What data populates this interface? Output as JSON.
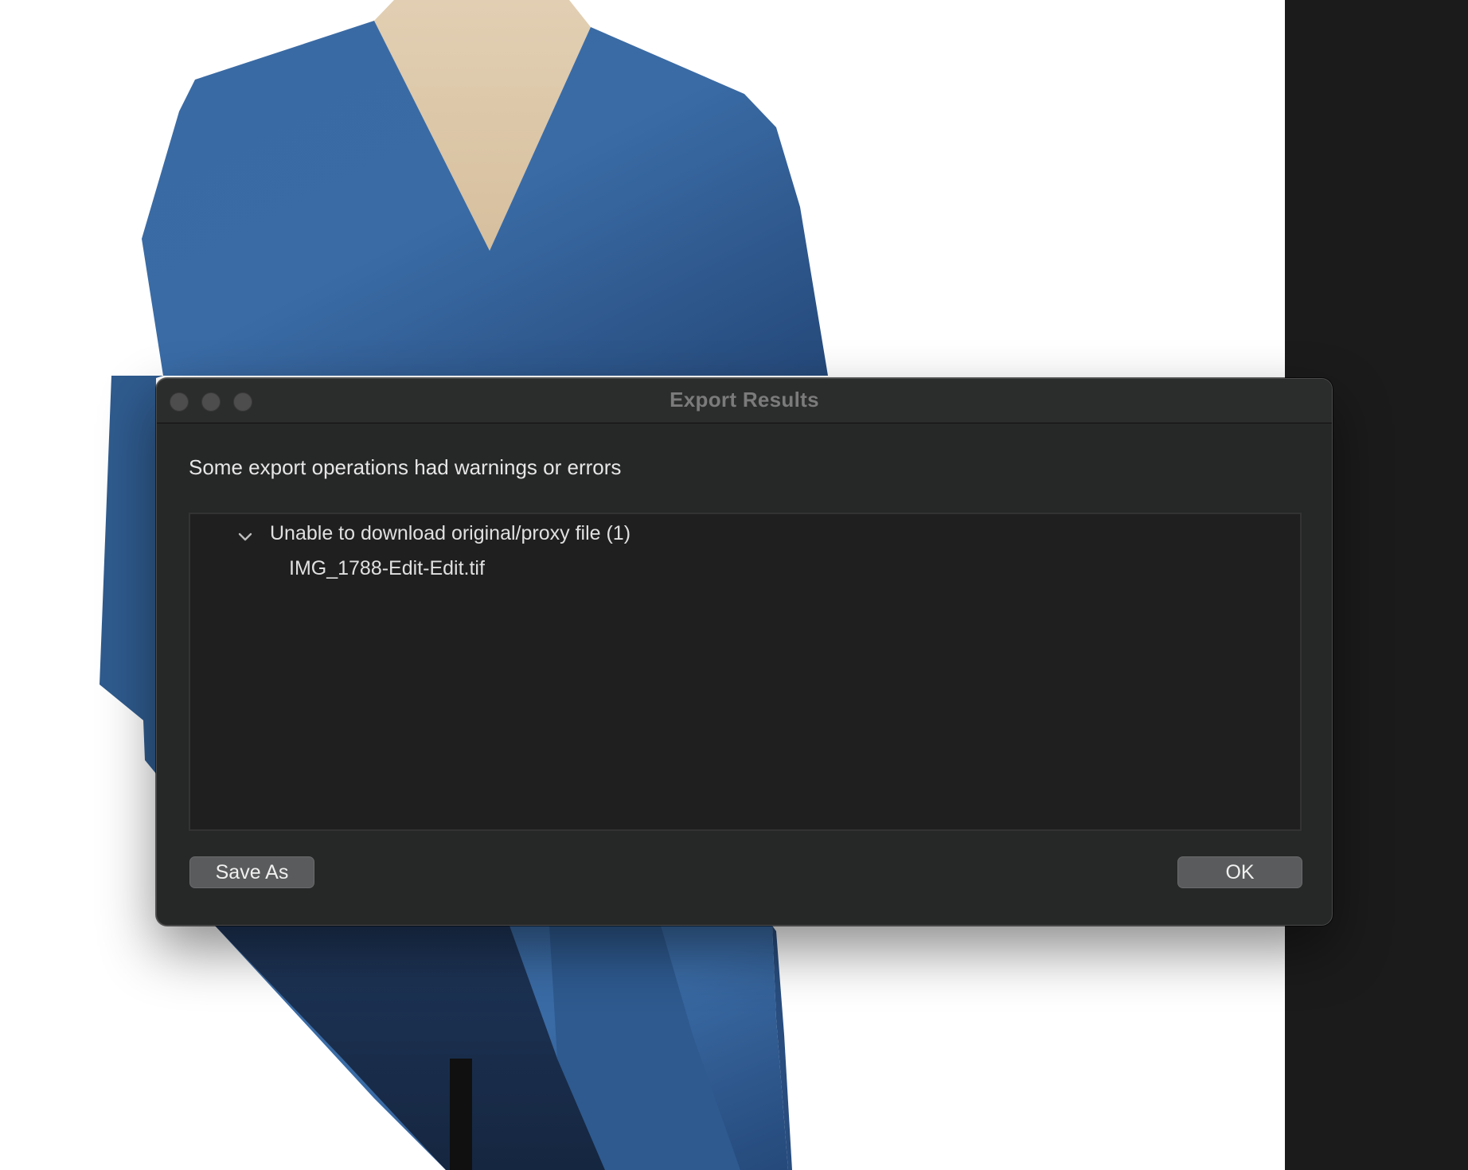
{
  "dialog": {
    "title": "Export Results",
    "message": "Some export operations had warnings or errors",
    "results": {
      "groups": [
        {
          "label": "Unable to download original/proxy file (1)",
          "expanded": true,
          "files": [
            "IMG_1788-Edit-Edit.tif"
          ]
        }
      ]
    },
    "buttons": {
      "save_as": "Save As",
      "ok": "OK"
    }
  },
  "colors": {
    "dialog_bg": "#262727",
    "results_bg": "#1f1f1f",
    "button_bg": "#5a5b5c",
    "right_panel": "#1b1b1b",
    "garment_blue": "#35639a"
  },
  "icons": {
    "window_close": "circle",
    "window_minimize": "circle",
    "window_maximize": "circle",
    "group_toggle": "chevron-down"
  }
}
